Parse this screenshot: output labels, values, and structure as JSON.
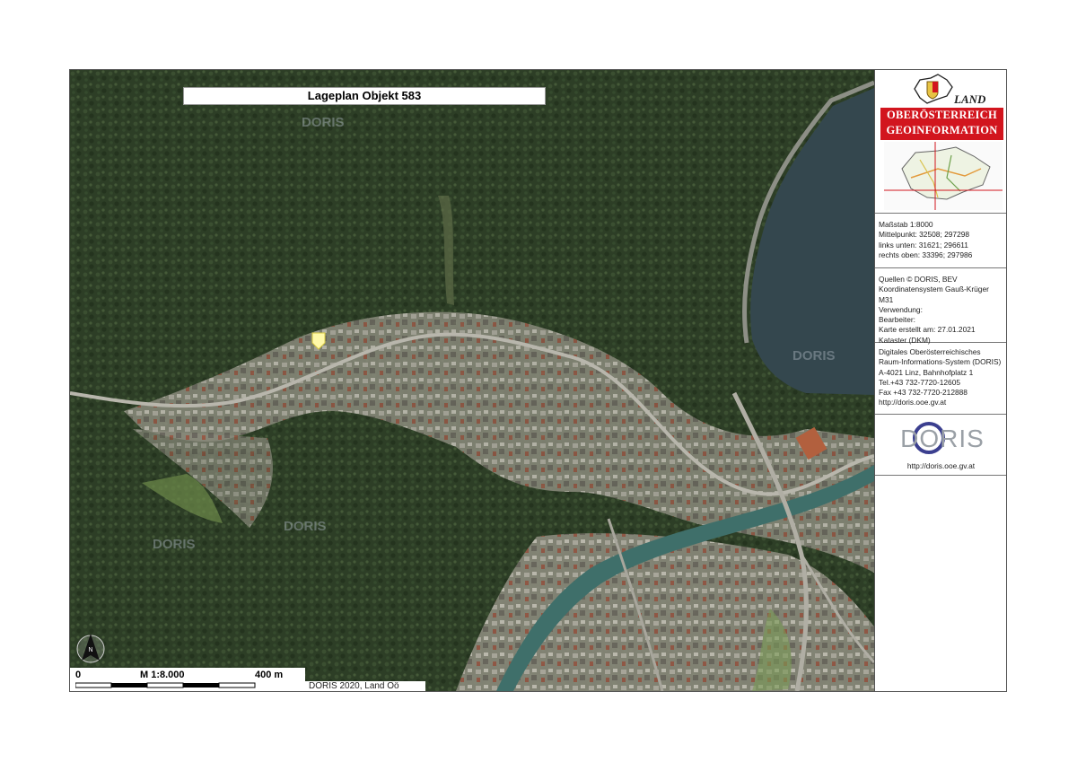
{
  "map": {
    "title": "Lageplan Objekt 583",
    "watermark": "DORIS",
    "north_label": "N",
    "marker_icon": "location-marker-icon",
    "scalebar": {
      "zero": "0",
      "scale": "M 1:8.000",
      "distance": "400 m"
    },
    "credit": "DORIS 2020, Land Oö"
  },
  "panel": {
    "logo": {
      "land": "LAND",
      "line1": "OBERÖSTERREICH",
      "line2": "GEOINFORMATION",
      "accent": "#d2151e"
    },
    "scale_info": [
      "Maßstab 1:8000",
      "Mittelpunkt: 32508; 297298",
      "links unten: 31621; 296611",
      "rechts oben: 33396; 297986"
    ],
    "meta_info": [
      "Quellen © DORIS, BEV",
      "Koordinatensystem Gauß-Krüger M31",
      "Verwendung:",
      "Bearbeiter:",
      "Karte erstellt am: 27.01.2021",
      "Kataster (DKM)"
    ],
    "contact_info": [
      "Digitales Oberösterreichisches",
      "Raum-Informations-System (DORIS)",
      "A-4021 Linz, Bahnhofplatz 1",
      "Tel.+43 732-7720-12605",
      "Fax +43 732-7720-212888",
      "http://doris.ooe.gv.at"
    ],
    "doris_logo_text": "DORIS",
    "doris_url": "http://doris.ooe.gv.at"
  }
}
